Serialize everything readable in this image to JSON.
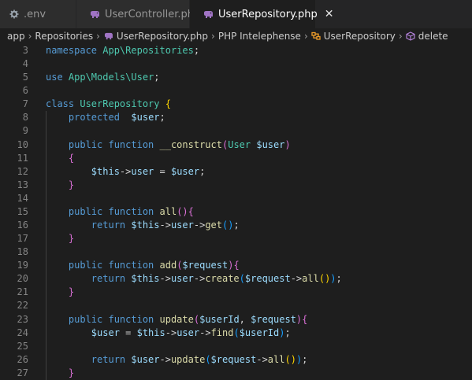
{
  "tabs": [
    {
      "label": ".env",
      "icon": "gear-icon",
      "active": false
    },
    {
      "label": "UserController.php",
      "icon": "php-elephant-icon",
      "active": false
    },
    {
      "label": "UserRepository.php",
      "icon": "php-elephant-icon",
      "active": true,
      "close_glyph": "✕"
    }
  ],
  "breadcrumbs": {
    "items": [
      "app",
      "Repositories",
      "UserRepository.php",
      "PHP Intelephense",
      "UserRepository",
      "delete"
    ],
    "separator": "›"
  },
  "editor": {
    "lines": [
      {
        "n": "3",
        "tokens": [
          [
            "kw",
            "namespace "
          ],
          [
            "ns",
            "App\\Repositories"
          ],
          [
            "pn",
            ";"
          ]
        ]
      },
      {
        "n": "4",
        "tokens": []
      },
      {
        "n": "5",
        "tokens": [
          [
            "kw",
            "use "
          ],
          [
            "ns",
            "App\\Models\\"
          ],
          [
            "cls",
            "User"
          ],
          [
            "pn",
            ";"
          ]
        ]
      },
      {
        "n": "6",
        "tokens": []
      },
      {
        "n": "7",
        "tokens": [
          [
            "kw",
            "class "
          ],
          [
            "cls",
            "UserRepository "
          ],
          [
            "b1",
            "{"
          ]
        ]
      },
      {
        "n": "8",
        "tokens": [
          [
            "pn",
            "    "
          ],
          [
            "kw",
            "protected  "
          ],
          [
            "var",
            "$user"
          ],
          [
            "pn",
            ";"
          ]
        ]
      },
      {
        "n": "9",
        "tokens": []
      },
      {
        "n": "10",
        "tokens": [
          [
            "pn",
            "    "
          ],
          [
            "kw",
            "public function "
          ],
          [
            "fn",
            "__construct"
          ],
          [
            "b2",
            "("
          ],
          [
            "cls",
            "User "
          ],
          [
            "var",
            "$user"
          ],
          [
            "b2",
            ")"
          ]
        ]
      },
      {
        "n": "11",
        "tokens": [
          [
            "pn",
            "    "
          ],
          [
            "b2",
            "{"
          ]
        ]
      },
      {
        "n": "12",
        "tokens": [
          [
            "pn",
            "        "
          ],
          [
            "var",
            "$this"
          ],
          [
            "pn",
            "->"
          ],
          [
            "var",
            "user"
          ],
          [
            "pn",
            " = "
          ],
          [
            "var",
            "$user"
          ],
          [
            "pn",
            ";"
          ]
        ]
      },
      {
        "n": "13",
        "tokens": [
          [
            "pn",
            "    "
          ],
          [
            "b2",
            "}"
          ]
        ]
      },
      {
        "n": "14",
        "tokens": []
      },
      {
        "n": "15",
        "tokens": [
          [
            "pn",
            "    "
          ],
          [
            "kw",
            "public function "
          ],
          [
            "fn",
            "all"
          ],
          [
            "b2",
            "(){"
          ]
        ]
      },
      {
        "n": "16",
        "tokens": [
          [
            "pn",
            "        "
          ],
          [
            "kw",
            "return "
          ],
          [
            "var",
            "$this"
          ],
          [
            "pn",
            "->"
          ],
          [
            "var",
            "user"
          ],
          [
            "pn",
            "->"
          ],
          [
            "fn",
            "get"
          ],
          [
            "b3",
            "()"
          ],
          [
            "pn",
            ";"
          ]
        ]
      },
      {
        "n": "17",
        "tokens": [
          [
            "pn",
            "    "
          ],
          [
            "b2",
            "}"
          ]
        ]
      },
      {
        "n": "18",
        "tokens": []
      },
      {
        "n": "19",
        "tokens": [
          [
            "pn",
            "    "
          ],
          [
            "kw",
            "public function "
          ],
          [
            "fn",
            "add"
          ],
          [
            "b2",
            "("
          ],
          [
            "var",
            "$request"
          ],
          [
            "b2",
            "){"
          ]
        ]
      },
      {
        "n": "20",
        "tokens": [
          [
            "pn",
            "        "
          ],
          [
            "kw",
            "return "
          ],
          [
            "var",
            "$this"
          ],
          [
            "pn",
            "->"
          ],
          [
            "var",
            "user"
          ],
          [
            "pn",
            "->"
          ],
          [
            "fn",
            "create"
          ],
          [
            "b3",
            "("
          ],
          [
            "var",
            "$request"
          ],
          [
            "pn",
            "->"
          ],
          [
            "fn",
            "all"
          ],
          [
            "b1",
            "()"
          ],
          [
            "b3",
            ")"
          ],
          [
            "pn",
            ";"
          ]
        ]
      },
      {
        "n": "21",
        "tokens": [
          [
            "pn",
            "    "
          ],
          [
            "b2",
            "}"
          ]
        ]
      },
      {
        "n": "22",
        "tokens": []
      },
      {
        "n": "23",
        "tokens": [
          [
            "pn",
            "    "
          ],
          [
            "kw",
            "public function "
          ],
          [
            "fn",
            "update"
          ],
          [
            "b2",
            "("
          ],
          [
            "var",
            "$userId"
          ],
          [
            "pn",
            ", "
          ],
          [
            "var",
            "$request"
          ],
          [
            "b2",
            "){"
          ]
        ]
      },
      {
        "n": "24",
        "tokens": [
          [
            "pn",
            "        "
          ],
          [
            "var",
            "$user"
          ],
          [
            "pn",
            " = "
          ],
          [
            "var",
            "$this"
          ],
          [
            "pn",
            "->"
          ],
          [
            "var",
            "user"
          ],
          [
            "pn",
            "->"
          ],
          [
            "fn",
            "find"
          ],
          [
            "b3",
            "("
          ],
          [
            "var",
            "$userId"
          ],
          [
            "b3",
            ")"
          ],
          [
            "pn",
            ";"
          ]
        ]
      },
      {
        "n": "25",
        "tokens": []
      },
      {
        "n": "26",
        "tokens": [
          [
            "pn",
            "        "
          ],
          [
            "kw",
            "return "
          ],
          [
            "var",
            "$user"
          ],
          [
            "pn",
            "->"
          ],
          [
            "fn",
            "update"
          ],
          [
            "b3",
            "("
          ],
          [
            "var",
            "$request"
          ],
          [
            "pn",
            "->"
          ],
          [
            "fn",
            "all"
          ],
          [
            "b1",
            "()"
          ],
          [
            "b3",
            ")"
          ],
          [
            "pn",
            ";"
          ]
        ]
      },
      {
        "n": "27",
        "tokens": [
          [
            "pn",
            "    "
          ],
          [
            "b2",
            "}"
          ]
        ]
      }
    ]
  }
}
